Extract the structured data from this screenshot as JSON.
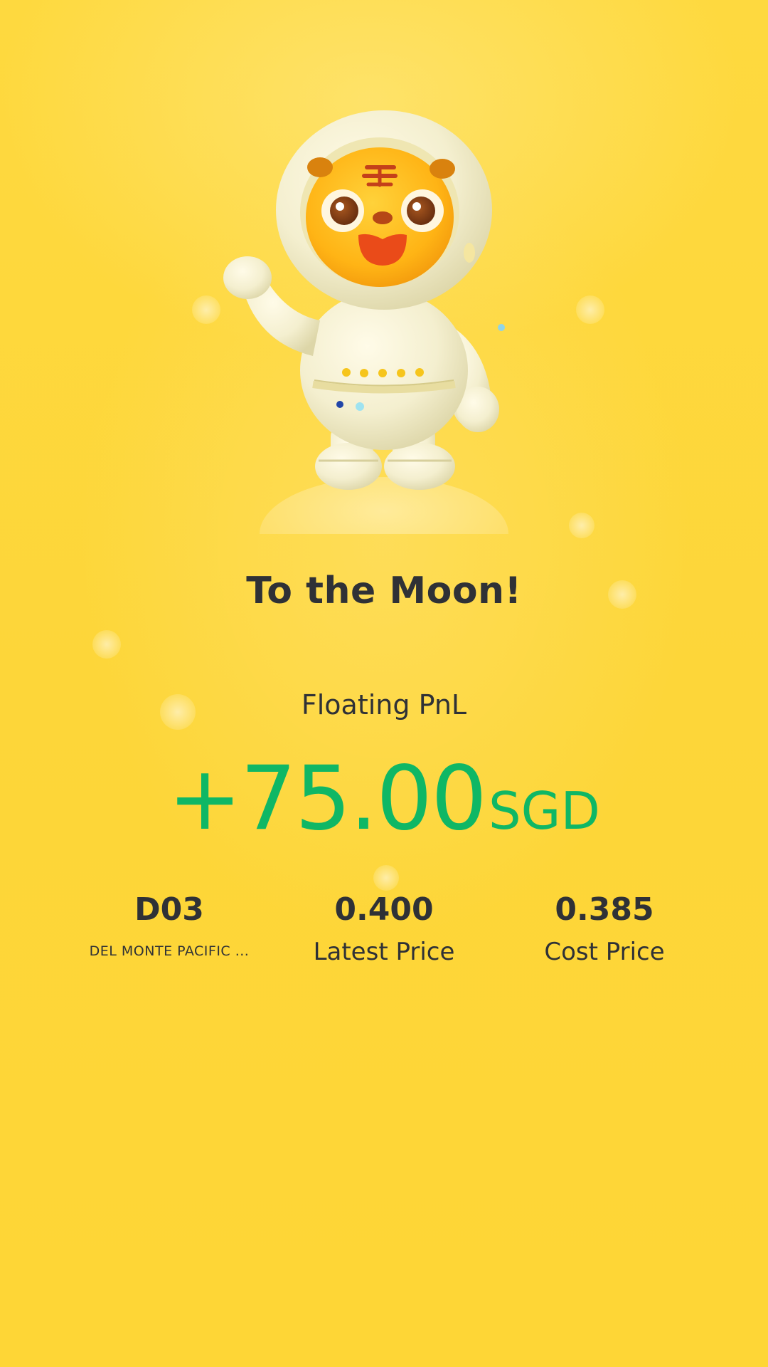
{
  "header": {
    "title": "To the Moon!"
  },
  "pnl": {
    "label": "Floating PnL",
    "value": "+75.00",
    "currency": "SGD",
    "color": "#0fb765"
  },
  "stock": {
    "code": "D03",
    "name": "DEL MONTE PACIFIC ..."
  },
  "latest_price": {
    "value": "0.400",
    "label": "Latest Price"
  },
  "cost_price": {
    "value": "0.385",
    "label": "Cost Price"
  },
  "mascot": {
    "icon": "tiger-astronaut-mascot-icon"
  },
  "theme": {
    "background": "#fdd63a",
    "text": "#2f3136"
  }
}
